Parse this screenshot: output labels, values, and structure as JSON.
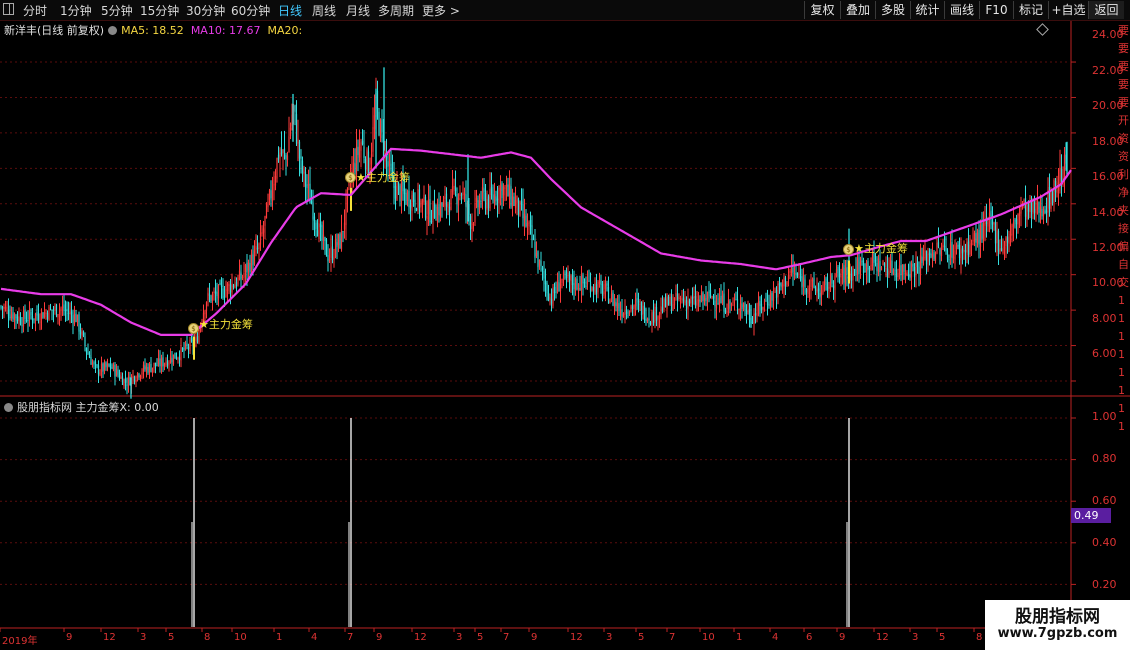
{
  "toolbar": {
    "periods": [
      "分时",
      "1分钟",
      "5分钟",
      "15分钟",
      "30分钟",
      "60分钟",
      "日线",
      "周线",
      "月线",
      "多周期",
      "更多 >"
    ],
    "active_period": "日线",
    "tools": [
      "复权",
      "叠加",
      "多股",
      "统计",
      "画线",
      "F10",
      "标记",
      "+自选",
      "返回"
    ]
  },
  "main_chart": {
    "title": "新洋丰(日线 前复权)",
    "ma5": "MA5: 18.52",
    "ma10": "MA10: 17.67",
    "ma20": "MA20:",
    "y_ticks": [
      "24.00",
      "22.00",
      "20.00",
      "18.00",
      "16.00",
      "14.00",
      "12.00",
      "10.00",
      "8.00",
      "6.00"
    ],
    "signal_labels": [
      "主力金筹",
      "主力金筹",
      "主力金筹"
    ],
    "colors": {
      "up": "#ff3b3b",
      "down": "#35e0e0",
      "ma": "#e83ce8",
      "bg": "#000000",
      "grid": "#5a0d0d"
    }
  },
  "sub_chart": {
    "title": "股朋指标网 主力金筹X: 0.00",
    "y_ticks": [
      "1.00",
      "0.80",
      "0.60",
      "0.40",
      "0.20"
    ],
    "current_value": "0.49"
  },
  "x_axis": {
    "labels": [
      "2019年",
      "9",
      "12",
      "3",
      "5",
      "8",
      "10",
      "1",
      "4",
      "7",
      "9",
      "12",
      "3",
      "5",
      "7",
      "9",
      "12",
      "3",
      "5",
      "7",
      "10",
      "1",
      "4",
      "6",
      "9",
      "12",
      "3",
      "5",
      "8"
    ]
  },
  "side_glyphs": [
    "要",
    "要",
    "要",
    "要",
    "要",
    "开",
    "资",
    "资",
    "利",
    "净",
    "夹",
    "接",
    "偏",
    "自",
    "交",
    "1",
    "1",
    "1",
    "1",
    "1",
    "1",
    "1",
    "1"
  ],
  "watermark": {
    "title": "股朋指标网",
    "url": "www.7gpzb.com"
  },
  "chart_data": [
    {
      "type": "candlestick",
      "title": "新洋丰(日线 前复权)",
      "ylim": [
        4.6,
        24.6
      ],
      "y_ticks": [
        24,
        22,
        20,
        18,
        16,
        14,
        12,
        10,
        8,
        6
      ],
      "price_path_index_close": [
        [
          0,
          10.2
        ],
        [
          20,
          9.5
        ],
        [
          40,
          9.8
        ],
        [
          60,
          10.1
        ],
        [
          75,
          9.6
        ],
        [
          85,
          7.8
        ],
        [
          95,
          6.6
        ],
        [
          110,
          6.8
        ],
        [
          125,
          5.9
        ],
        [
          140,
          6.6
        ],
        [
          160,
          7.0
        ],
        [
          180,
          7.6
        ],
        [
          195,
          8.2
        ],
        [
          205,
          10.6
        ],
        [
          220,
          11.0
        ],
        [
          240,
          11.8
        ],
        [
          258,
          13.5
        ],
        [
          268,
          16.0
        ],
        [
          278,
          19.0
        ],
        [
          285,
          18.5
        ],
        [
          292,
          21.5
        ],
        [
          300,
          18.0
        ],
        [
          310,
          16.2
        ],
        [
          320,
          14.0
        ],
        [
          328,
          13.0
        ],
        [
          340,
          14.0
        ],
        [
          350,
          17.5
        ],
        [
          360,
          19.5
        ],
        [
          368,
          18.0
        ],
        [
          375,
          21.5
        ],
        [
          383,
          19.0
        ],
        [
          392,
          17.0
        ],
        [
          402,
          16.5
        ],
        [
          415,
          16.3
        ],
        [
          430,
          15.5
        ],
        [
          445,
          16.0
        ],
        [
          460,
          16.8
        ],
        [
          470,
          15.0
        ],
        [
          480,
          16.3
        ],
        [
          490,
          16.2
        ],
        [
          500,
          17.0
        ],
        [
          515,
          16.0
        ],
        [
          528,
          14.5
        ],
        [
          540,
          12.2
        ],
        [
          550,
          10.6
        ],
        [
          560,
          11.7
        ],
        [
          575,
          11.5
        ],
        [
          590,
          11.5
        ],
        [
          605,
          11.0
        ],
        [
          620,
          10.0
        ],
        [
          635,
          10.3
        ],
        [
          650,
          9.6
        ],
        [
          665,
          10.3
        ],
        [
          680,
          10.6
        ],
        [
          695,
          10.4
        ],
        [
          710,
          10.8
        ],
        [
          725,
          10.3
        ],
        [
          740,
          10.4
        ],
        [
          750,
          9.6
        ],
        [
          765,
          10.5
        ],
        [
          780,
          11.3
        ],
        [
          790,
          12.2
        ],
        [
          805,
          11.5
        ],
        [
          820,
          11.0
        ],
        [
          835,
          11.9
        ],
        [
          848,
          12.0
        ],
        [
          858,
          12.5
        ],
        [
          870,
          12.7
        ],
        [
          885,
          12.4
        ],
        [
          900,
          12.3
        ],
        [
          915,
          12.4
        ],
        [
          930,
          13.3
        ],
        [
          945,
          13.4
        ],
        [
          960,
          13.3
        ],
        [
          975,
          14.0
        ],
        [
          990,
          15.0
        ],
        [
          1000,
          13.5
        ],
        [
          1010,
          14.3
        ],
        [
          1020,
          15.8
        ],
        [
          1030,
          15.5
        ],
        [
          1045,
          16.0
        ],
        [
          1055,
          17.0
        ],
        [
          1065,
          18.3
        ]
      ],
      "ma_line_index_value": [
        [
          0,
          11.2
        ],
        [
          40,
          10.9
        ],
        [
          70,
          10.9
        ],
        [
          100,
          10.3
        ],
        [
          130,
          9.3
        ],
        [
          160,
          8.6
        ],
        [
          190,
          8.6
        ],
        [
          215,
          9.8
        ],
        [
          245,
          11.5
        ],
        [
          270,
          13.8
        ],
        [
          295,
          15.8
        ],
        [
          320,
          16.6
        ],
        [
          350,
          16.5
        ],
        [
          370,
          17.8
        ],
        [
          390,
          19.1
        ],
        [
          420,
          19.0
        ],
        [
          450,
          18.8
        ],
        [
          480,
          18.6
        ],
        [
          510,
          18.9
        ],
        [
          530,
          18.6
        ],
        [
          550,
          17.4
        ],
        [
          580,
          15.8
        ],
        [
          620,
          14.5
        ],
        [
          660,
          13.2
        ],
        [
          700,
          12.8
        ],
        [
          740,
          12.6
        ],
        [
          775,
          12.3
        ],
        [
          800,
          12.6
        ],
        [
          830,
          13.0
        ],
        [
          850,
          13.1
        ],
        [
          880,
          13.6
        ],
        [
          900,
          13.9
        ],
        [
          925,
          13.9
        ],
        [
          960,
          14.6
        ],
        [
          1000,
          15.4
        ],
        [
          1040,
          16.4
        ],
        [
          1060,
          17.1
        ],
        [
          1070,
          17.9
        ]
      ],
      "signals_index_price": [
        [
          193,
          7.6
        ],
        [
          350,
          16.0
        ],
        [
          848,
          11.9
        ]
      ],
      "signal_label": "主力金筹",
      "ma5": 18.52,
      "ma10": 17.67
    },
    {
      "type": "bar",
      "title": "股朋指标网 主力金筹X: 0.00",
      "ylim": [
        0,
        1.1
      ],
      "y_ticks": [
        1.0,
        0.8,
        0.6,
        0.4,
        0.2
      ],
      "spikes_index_value": [
        [
          193,
          1.0
        ],
        [
          350,
          1.0
        ],
        [
          848,
          1.0
        ]
      ],
      "current_value": 0.49
    }
  ]
}
